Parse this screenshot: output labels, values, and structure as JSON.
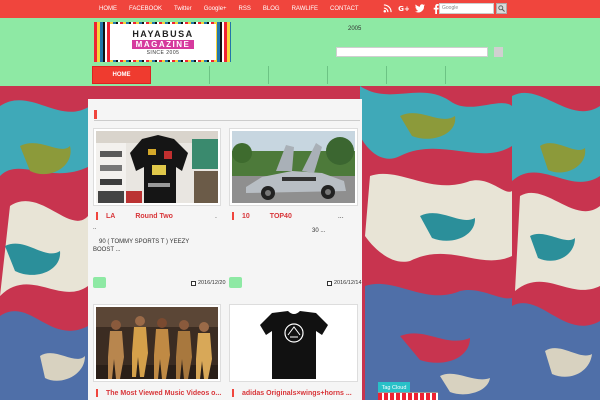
{
  "top_nav": {
    "items": [
      "HOME",
      "FACEBOOK",
      "Twitter",
      "Google+",
      "RSS",
      "BLOG",
      "RAWLIFE",
      "CONTACT"
    ]
  },
  "social_icons": [
    "rss-icon",
    "google-plus-icon",
    "twitter-icon",
    "facebook-icon"
  ],
  "google_search": {
    "placeholder": "Google"
  },
  "logo": {
    "line1": "HAYABUSA",
    "line2": "MAGAZINE",
    "line3": "SINCE 2005"
  },
  "header": {
    "year": "2005"
  },
  "main_nav": {
    "home": "HOME"
  },
  "posts": [
    {
      "title_a": "LA",
      "title_b": "Round Two",
      "title_c": ".",
      "excerpt_top": "..",
      "excerpt_line1": "90        (    TOMMY SPORTS T    )  YEEZY",
      "excerpt_line2": "BOOST        ...",
      "date": "2016/12/20"
    },
    {
      "title_a": "10",
      "title_b": "TOP40",
      "title_c": "...",
      "excerpt_line1": "30      ...",
      "date": "2016/12/14"
    },
    {
      "title": "The Most Viewed Music Videos o..."
    },
    {
      "title": "adidas Originals×wings+horns ..."
    }
  ],
  "sidebar": {
    "tag_cloud": "Tag Cloud"
  },
  "colors": {
    "top_bar": "#f0453d",
    "header": "#8ee9a4",
    "accent_red": "#d8363a",
    "tag_cloud": "#29c0c8"
  }
}
